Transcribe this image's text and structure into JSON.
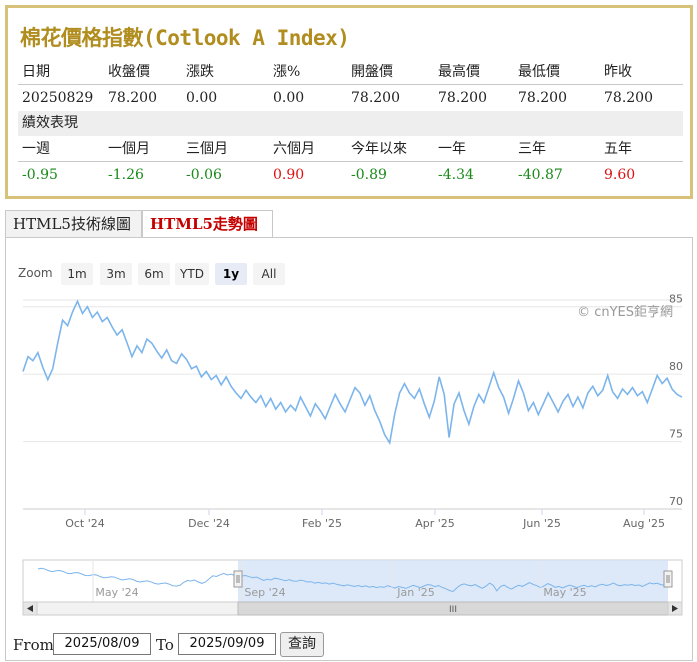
{
  "quote": {
    "title": "棉花價格指數(Cotlook A Index)",
    "headers": [
      "日期",
      "收盤價",
      "漲跌",
      "漲%",
      "開盤價",
      "最高價",
      "最低價",
      "昨收"
    ],
    "values": [
      "20250829",
      "78.200",
      "0.00",
      "0.00",
      "78.200",
      "78.200",
      "78.200",
      "78.200"
    ],
    "performance_label": "績效表現",
    "perf_headers": [
      "一週",
      "一個月",
      "三個月",
      "六個月",
      "今年以來",
      "一年",
      "三年",
      "五年"
    ],
    "perf_values": [
      "-0.95",
      "-1.26",
      "-0.06",
      "0.90",
      "-0.89",
      "-4.34",
      "-40.87",
      "9.60"
    ],
    "perf_signs": [
      "neg",
      "neg",
      "neg",
      "pos",
      "neg",
      "neg",
      "neg",
      "pos"
    ],
    "colors": {
      "positive": "#d11111",
      "negative": "#1a8a1a",
      "title": "#b08d1e",
      "border": "#d8c27a"
    }
  },
  "tabs": [
    {
      "label": "HTML5技術線圖",
      "active": false
    },
    {
      "label": "HTML5走勢圖",
      "active": true
    }
  ],
  "zoom": {
    "label": "Zoom",
    "buttons": [
      {
        "label": "1m",
        "active": false
      },
      {
        "label": "3m",
        "active": false
      },
      {
        "label": "6m",
        "active": false
      },
      {
        "label": "YTD",
        "active": false
      },
      {
        "label": "1y",
        "active": true
      },
      {
        "label": "All",
        "active": false
      }
    ]
  },
  "chart": {
    "credit": "© cnYES鉅亨網",
    "line_color": "#7cb5ec",
    "navigator_labels": [
      "May '24",
      "Sep '24",
      "Jan '25",
      "May '25"
    ],
    "navigator_handle_glyph": "III"
  },
  "chart_data": {
    "type": "line",
    "x_labels": [
      "Oct '24",
      "Dec '24",
      "Feb '25",
      "Apr '25",
      "Jun '25",
      "Aug '25"
    ],
    "y_ticks": [
      70,
      75,
      80,
      85
    ],
    "ylim": [
      70,
      85.5
    ],
    "series": [
      {
        "values": [
          80.2,
          81.3,
          81.0,
          81.6,
          80.5,
          79.6,
          80.4,
          82.3,
          84.0,
          83.6,
          84.6,
          85.4,
          84.5,
          85.0,
          84.2,
          84.6,
          83.9,
          84.2,
          83.5,
          82.9,
          83.3,
          82.3,
          81.3,
          82.1,
          81.6,
          82.6,
          82.3,
          81.7,
          81.2,
          81.8,
          81.0,
          80.8,
          81.5,
          81.1,
          80.4,
          80.6,
          79.8,
          80.2,
          79.6,
          79.9,
          79.2,
          79.8,
          79.1,
          78.6,
          78.2,
          78.8,
          78.3,
          77.9,
          78.4,
          77.6,
          78.2,
          77.4,
          77.9,
          77.2,
          77.7,
          77.3,
          78.3,
          77.6,
          76.9,
          77.8,
          77.3,
          76.7,
          77.6,
          78.5,
          77.8,
          77.2,
          78.1,
          79.0,
          78.6,
          77.7,
          78.4,
          77.3,
          76.5,
          75.5,
          74.9,
          77.0,
          78.6,
          79.3,
          78.6,
          78.2,
          78.9,
          77.8,
          76.8,
          78.0,
          79.8,
          78.5,
          75.3,
          77.8,
          78.6,
          77.3,
          76.3,
          77.6,
          78.5,
          77.9,
          79.0,
          80.1,
          79.0,
          78.3,
          77.1,
          78.2,
          79.5,
          78.6,
          77.3,
          77.9,
          77.0,
          77.8,
          78.6,
          77.9,
          77.2,
          78.0,
          78.5,
          77.6,
          78.3,
          77.5,
          78.6,
          79.1,
          78.4,
          78.8,
          79.9,
          78.7,
          78.2,
          78.9,
          78.5,
          79.0,
          78.4,
          78.7,
          77.9,
          78.9,
          79.9,
          79.3,
          79.7,
          78.9,
          78.5,
          78.3
        ]
      }
    ]
  },
  "controls": {
    "from_label": "From",
    "from_value": "2025/08/09",
    "to_label": "To",
    "to_value": "2025/09/09",
    "query_label": "查詢"
  }
}
